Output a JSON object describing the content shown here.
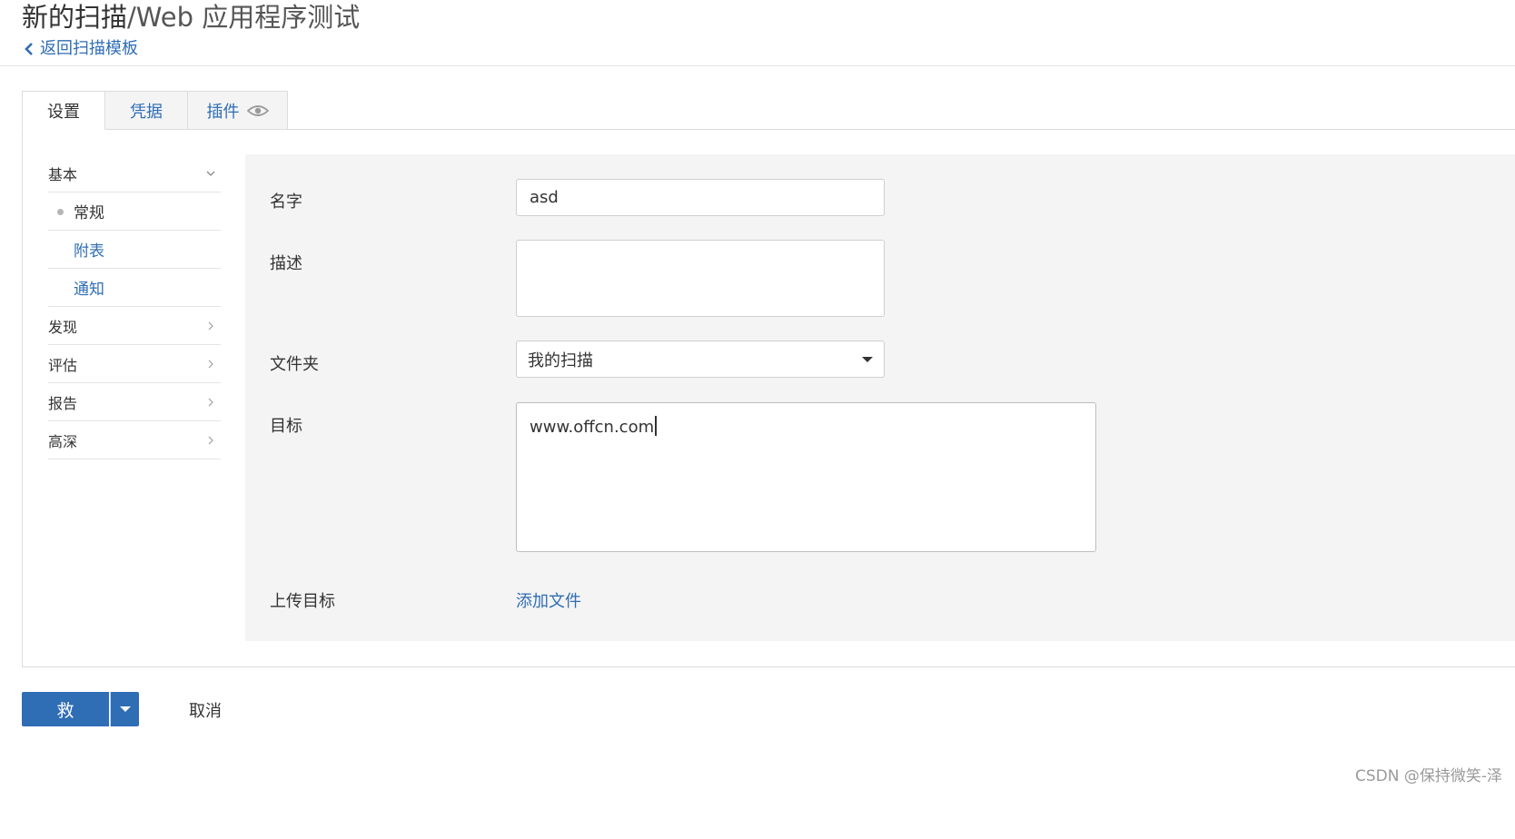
{
  "header": {
    "title_main": "新的扫描",
    "title_sub": "/Web 应用程序测试",
    "back_link": "返回扫描模板"
  },
  "tabs": [
    {
      "label": "设置",
      "active": true
    },
    {
      "label": "凭据",
      "active": false
    },
    {
      "label": "插件",
      "active": false,
      "icon": "eye-icon"
    }
  ],
  "sidenav": {
    "sections": [
      {
        "label": "基本",
        "expanded": true,
        "icon": "chevron-down-icon"
      },
      {
        "label": "发现",
        "icon": "chevron-right-icon"
      },
      {
        "label": "评估",
        "icon": "chevron-right-icon"
      },
      {
        "label": "报告",
        "icon": "chevron-right-icon"
      },
      {
        "label": "高深",
        "icon": "chevron-right-icon"
      }
    ],
    "basic_items": [
      {
        "label": "常规",
        "active": true
      },
      {
        "label": "附表",
        "active": false
      },
      {
        "label": "通知",
        "active": false
      }
    ]
  },
  "form": {
    "name_label": "名字",
    "name_value": "asd",
    "description_label": "描述",
    "description_value": "",
    "folder_label": "文件夹",
    "folder_value": "我的扫描",
    "targets_label": "目标",
    "targets_value": "www.offcn.com",
    "upload_label": "上传目标",
    "add_file_link": "添加文件"
  },
  "footer": {
    "save_label": "救",
    "cancel_label": "取消",
    "watermark": "CSDN @保持微笑-泽"
  },
  "colors": {
    "accent": "#2f6db5",
    "form_bg": "#f4f4f4",
    "border": "#dcdcdc"
  }
}
